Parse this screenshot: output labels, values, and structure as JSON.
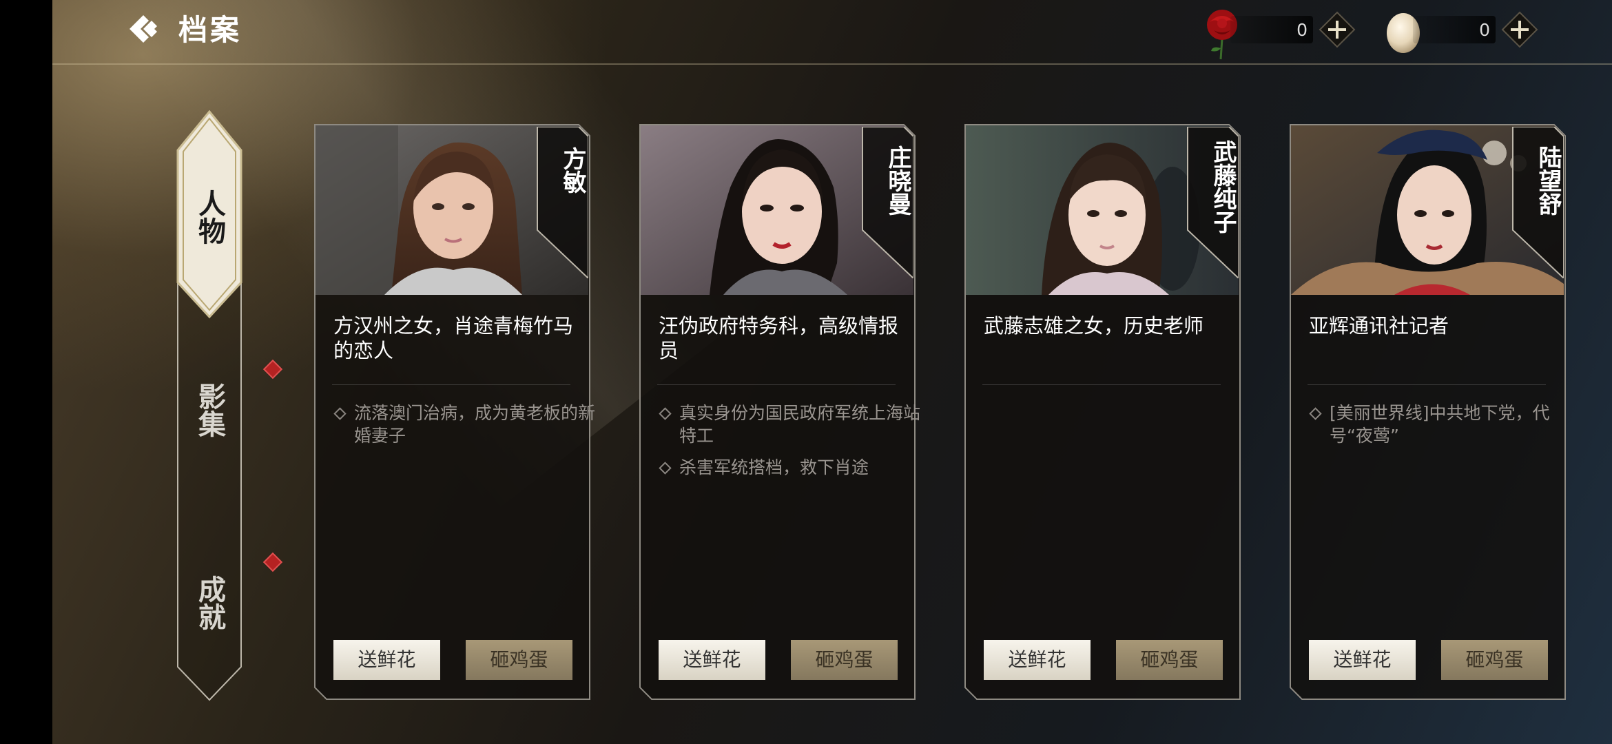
{
  "header": {
    "title": "档案"
  },
  "currencies": [
    {
      "name": "rose",
      "value": "0"
    },
    {
      "name": "egg",
      "value": "0"
    }
  ],
  "sidenav": {
    "items": [
      {
        "label": "人物",
        "active": true,
        "badge": false
      },
      {
        "label": "影集",
        "active": false,
        "badge": true
      },
      {
        "label": "成就",
        "active": false,
        "badge": true
      }
    ]
  },
  "characters": [
    {
      "name": "方敏",
      "desc": "方汉州之女，肖途青梅竹马的恋人",
      "tags": [
        "流落澳门治病，成为黄老板的新婚妻子"
      ],
      "flower_label": "送鲜花",
      "egg_label": "砸鸡蛋"
    },
    {
      "name": "庄晓曼",
      "desc": "汪伪政府特务科，高级情报员",
      "tags": [
        "真实身份为国民政府军统上海站特工",
        "杀害军统搭档，救下肖途"
      ],
      "flower_label": "送鲜花",
      "egg_label": "砸鸡蛋"
    },
    {
      "name": "武藤纯子",
      "desc": "武藤志雄之女，历史老师",
      "tags": [],
      "flower_label": "送鲜花",
      "egg_label": "砸鸡蛋"
    },
    {
      "name": "陆望舒",
      "desc": "亚辉通讯社记者",
      "tags": [
        "[美丽世界线]中共地下党，代号“夜莺”"
      ],
      "flower_label": "送鲜花",
      "egg_label": "砸鸡蛋"
    }
  ],
  "colors": {
    "accent_gold": "#c9b98f",
    "badge_red": "#b52222",
    "button_light": "#efebe1",
    "button_dark": "#9a8b6b"
  }
}
